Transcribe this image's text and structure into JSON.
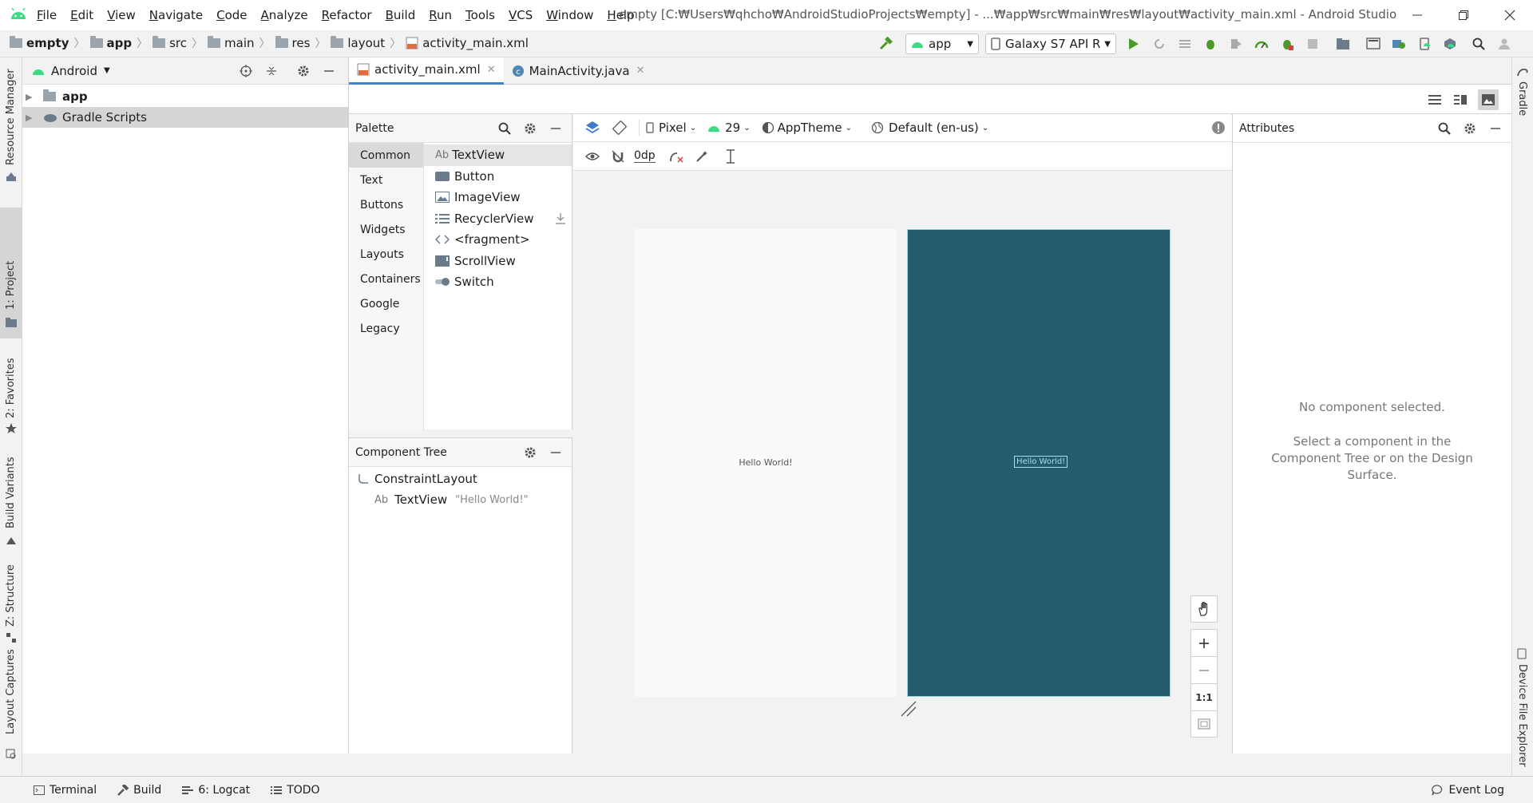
{
  "menu": [
    "File",
    "Edit",
    "View",
    "Navigate",
    "Code",
    "Analyze",
    "Refactor",
    "Build",
    "Run",
    "Tools",
    "VCS",
    "Window",
    "Help"
  ],
  "window_title": "empty [C:₩Users₩qhcho₩AndroidStudioProjects₩empty] - ...₩app₩src₩main₩res₩layout₩activity_main.xml - Android Studio",
  "breadcrumbs": [
    "empty",
    "app",
    "src",
    "main",
    "res",
    "layout",
    "activity_main.xml"
  ],
  "run_config": "app",
  "device": "Galaxy S7 API R",
  "left_tools": [
    "Resource Manager",
    "1: Project",
    "2: Favorites",
    "Build Variants",
    "Z: Structure",
    "Layout Captures"
  ],
  "right_tools": [
    "Gradle",
    "Device File Explorer"
  ],
  "project": {
    "view_mode": "Android",
    "items": [
      "app",
      "Gradle Scripts"
    ]
  },
  "tabs": [
    "activity_main.xml",
    "MainActivity.java"
  ],
  "palette": {
    "title": "Palette",
    "categories": [
      "Common",
      "Text",
      "Buttons",
      "Widgets",
      "Layouts",
      "Containers",
      "Google",
      "Legacy"
    ],
    "items": [
      "TextView",
      "Button",
      "ImageView",
      "RecyclerView",
      "<fragment>",
      "ScrollView",
      "Switch"
    ],
    "textview_prefix": "Ab"
  },
  "design_toolbar": {
    "device": "Pixel",
    "api": "29",
    "theme": "AppTheme",
    "locale": "Default (en-us)",
    "margin": "0dp"
  },
  "component_tree": {
    "title": "Component Tree",
    "root": "ConstraintLayout",
    "child": "TextView",
    "child_prefix": "Ab",
    "child_text": "\"Hello World!\""
  },
  "canvas": {
    "design_text": "Hello World!",
    "blueprint_text": "Hello World!",
    "zoom_fit": "1:1",
    "screen_color": "#225c6d"
  },
  "attributes": {
    "title": "Attributes",
    "empty_title": "No component selected.",
    "empty_hint": "Select a component in the Component Tree or on the Design Surface."
  },
  "statusbar": {
    "items": [
      "Terminal",
      "Build",
      "6: Logcat",
      "TODO"
    ],
    "event_log": "Event Log"
  }
}
